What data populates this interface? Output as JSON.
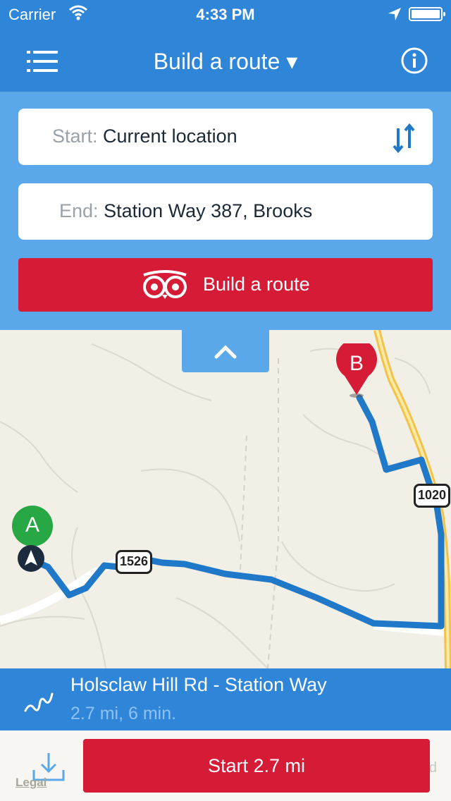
{
  "status_bar": {
    "carrier": "Carrier",
    "time": "4:33 PM"
  },
  "nav": {
    "title": "Build a route ▾",
    "menu_icon": "menu-icon",
    "info_icon": "info-icon"
  },
  "route_form": {
    "start_label": "Start:",
    "start_value": "Current location",
    "end_label": "End:",
    "end_value": "Station Way 387, Brooks",
    "build_label": "Build a route"
  },
  "map": {
    "marker_a": "A",
    "marker_b": "B",
    "shields": [
      "1020",
      "1526"
    ]
  },
  "route_info": {
    "name": "Holsclaw Hill Rd - Station Way",
    "summary": "2.7 mi, 6 min."
  },
  "bottom": {
    "legal": "Legal",
    "start_label": "Start 2.7 mi",
    "right_fragment": "d"
  },
  "colors": {
    "primary_blue": "#2f86d8",
    "panel_blue": "#5aa8ea",
    "accent_red": "#d51b36",
    "route_blue": "#1f78c8",
    "marker_green": "#27a844"
  }
}
